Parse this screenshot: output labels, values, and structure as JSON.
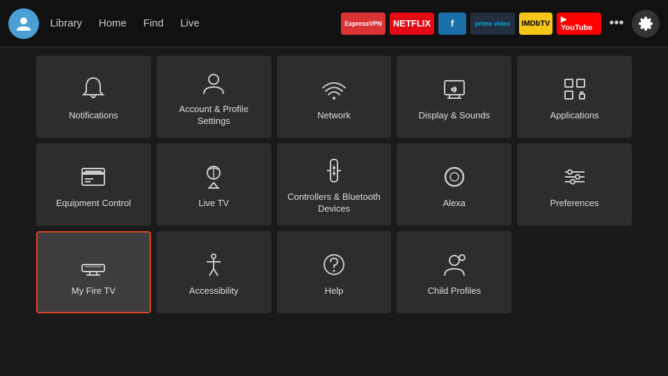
{
  "navbar": {
    "links": [
      "Library",
      "Home",
      "Find",
      "Live"
    ],
    "apps": [
      {
        "label": "ExpressVPN",
        "class": "app-expressvpn"
      },
      {
        "label": "NETFLIX",
        "class": "app-netflix"
      },
      {
        "label": "f",
        "class": "app-freevee"
      },
      {
        "label": "prime video",
        "class": "app-prime"
      },
      {
        "label": "IMDbTV",
        "class": "app-imdb"
      },
      {
        "label": "▶ YouTube",
        "class": "app-youtube"
      }
    ],
    "more": "•••",
    "settings": "⚙"
  },
  "grid": {
    "items": [
      {
        "id": "notifications",
        "label": "Notifications",
        "icon": "bell"
      },
      {
        "id": "account-profile",
        "label": "Account & Profile Settings",
        "icon": "person"
      },
      {
        "id": "network",
        "label": "Network",
        "icon": "wifi"
      },
      {
        "id": "display-sounds",
        "label": "Display & Sounds",
        "icon": "display"
      },
      {
        "id": "applications",
        "label": "Applications",
        "icon": "apps"
      },
      {
        "id": "equipment-control",
        "label": "Equipment Control",
        "icon": "tv"
      },
      {
        "id": "live-tv",
        "label": "Live TV",
        "icon": "antenna"
      },
      {
        "id": "controllers-bluetooth",
        "label": "Controllers & Bluetooth Devices",
        "icon": "remote"
      },
      {
        "id": "alexa",
        "label": "Alexa",
        "icon": "alexa"
      },
      {
        "id": "preferences",
        "label": "Preferences",
        "icon": "sliders"
      },
      {
        "id": "my-fire-tv",
        "label": "My Fire TV",
        "icon": "firetv",
        "selected": true
      },
      {
        "id": "accessibility",
        "label": "Accessibility",
        "icon": "accessibility"
      },
      {
        "id": "help",
        "label": "Help",
        "icon": "help"
      },
      {
        "id": "child-profiles",
        "label": "Child Profiles",
        "icon": "child"
      }
    ]
  }
}
